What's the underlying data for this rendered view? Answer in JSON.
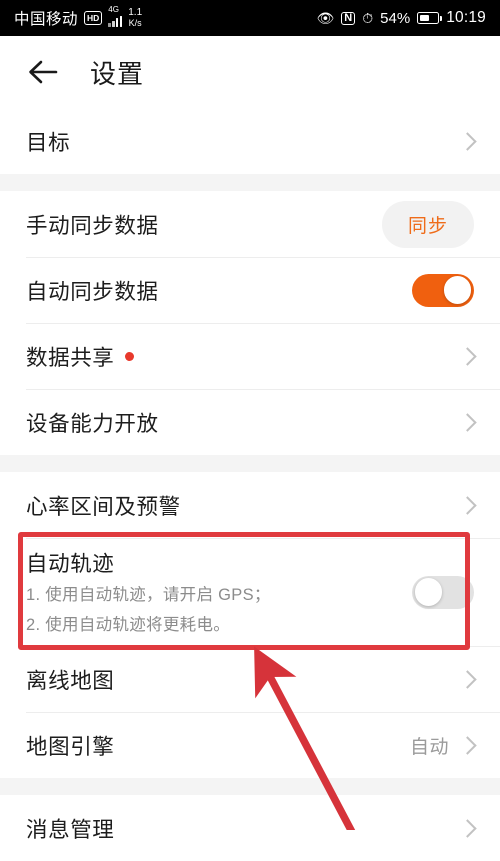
{
  "status_bar": {
    "carrier": "中国移动",
    "hd_badge": "HD",
    "network_type": "4G",
    "data_rate_value": "1.1",
    "data_rate_unit": "K/s",
    "eye_comfort_icon": "eye-icon",
    "nfc_icon": "nfc-icon",
    "alarm_icon": "alarm-clock-icon",
    "battery_percent": "54%",
    "battery_icon": "battery-icon",
    "time": "10:19"
  },
  "header": {
    "back_icon": "back-arrow-icon",
    "title": "设置"
  },
  "sections": [
    {
      "rows": [
        {
          "label": "目标",
          "accessory": "chevron"
        }
      ]
    },
    {
      "rows": [
        {
          "label": "手动同步数据",
          "accessory": "pill",
          "pill_label": "同步"
        },
        {
          "label": "自动同步数据",
          "accessory": "toggle",
          "toggle_state": "on"
        },
        {
          "label": "数据共享",
          "accessory": "chevron",
          "badge": "dot"
        },
        {
          "label": "设备能力开放",
          "accessory": "chevron"
        }
      ]
    },
    {
      "rows": [
        {
          "label": "心率区间及预警",
          "accessory": "chevron"
        },
        {
          "label": "自动轨迹",
          "accessory": "toggle",
          "toggle_state": "off",
          "sub_lines": [
            "1. 使用自动轨迹，请开启 GPS；",
            "2. 使用自动轨迹将更耗电。"
          ],
          "highlighted": true
        },
        {
          "label": "离线地图",
          "accessory": "chevron"
        },
        {
          "label": "地图引擎",
          "accessory": "chevron",
          "value": "自动"
        }
      ]
    },
    {
      "rows": [
        {
          "label": "消息管理",
          "accessory": "chevron"
        }
      ]
    }
  ],
  "annotations": {
    "highlight_box_color": "#e03a3e",
    "arrow_color": "#d6333a",
    "arrow_points_to": "自动轨迹"
  },
  "colors": {
    "accent_orange": "#f0600f",
    "pill_text": "#ef6c1a",
    "badge_red": "#e8392c",
    "page_background": "#f4f4f4",
    "row_background": "#ffffff"
  }
}
